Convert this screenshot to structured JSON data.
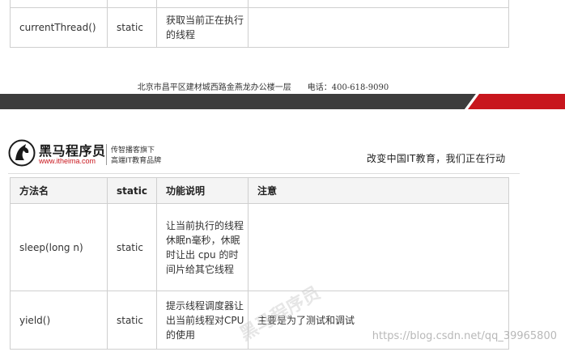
{
  "top_table": {
    "rows": [
      {
        "method": "",
        "static": "",
        "desc": "",
        "note": ""
      },
      {
        "method": "currentThread()",
        "static": "static",
        "desc": "获取当前正在执行的线程",
        "note": ""
      }
    ]
  },
  "footer": {
    "address": "北京市昌平区建材城西路金燕龙办公楼一层",
    "phone": "电话：400-618-9090"
  },
  "colors": {
    "band_dark": "#3d3d3d",
    "band_red": "#c8161d",
    "header_bg": "#f4f4f4",
    "brand_red": "#c9161d"
  },
  "header": {
    "brand_name": "黑马程序员",
    "brand_url": "www.itheima.com",
    "tagline_1": "传智播客旗下",
    "tagline_2": "高端IT教育品牌",
    "slogan": "改变中国IT教育，我们正在行动",
    "logo_icon": "horse-head-icon"
  },
  "main_table": {
    "columns": [
      "方法名",
      "static",
      "功能说明",
      "注意"
    ],
    "rows": [
      {
        "method": "sleep(long n)",
        "static": "static",
        "desc": "让当前执行的线程休眠n毫秒，休眠时让出 cpu 的时间片给其它线程",
        "note": ""
      },
      {
        "method": "yield()",
        "static": "static",
        "desc": "提示线程调度器让出当前线程对CPU的使用",
        "note": "主要是为了测试和调试"
      }
    ]
  },
  "watermark": {
    "csdn": "https://blog.csdn.net/qq_39965800",
    "diagonal": "黑马程序员"
  }
}
